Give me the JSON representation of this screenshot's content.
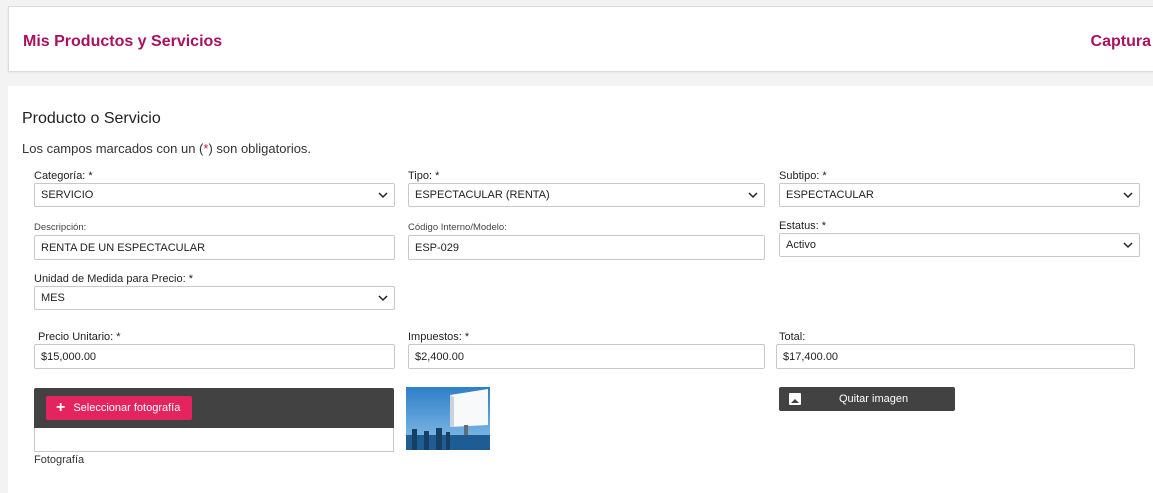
{
  "header": {
    "title": "Mis Productos y Servicios",
    "right_link": "Captura"
  },
  "section": {
    "title": "Producto o Servicio",
    "note_before": "Los campos marcados con un (",
    "note_star": "*",
    "note_after": ") son obligatorios."
  },
  "fields": {
    "categoria": {
      "label": "Categoría: *",
      "value": "SERVICIO"
    },
    "tipo": {
      "label": "Tipo: *",
      "value": "ESPECTACULAR (RENTA)"
    },
    "subtipo": {
      "label": "Subtipo: *",
      "value": "ESPECTACULAR"
    },
    "descripcion": {
      "label": "Descripción:",
      "value": "RENTA DE UN ESPECTACULAR"
    },
    "codigo": {
      "label": "Código Interno/Modelo:",
      "value": "ESP-029"
    },
    "estatus": {
      "label": "Estatus: *",
      "value": "Activo"
    },
    "unidad": {
      "label": "Unidad de Medida para Precio: *",
      "value": "MES"
    },
    "precio": {
      "label": "Precio Unitario: *",
      "value": "$15,000.00"
    },
    "impuestos": {
      "label": "Impuestos: *",
      "value": "$2,400.00"
    },
    "total": {
      "label": "Total:",
      "value": "$17,400.00"
    }
  },
  "photo": {
    "select_button": "Seleccionar fotografía",
    "label": "Fotografía",
    "remove_button": "Quitar imagen"
  },
  "colors": {
    "brand": "#a8125f",
    "accent_button": "#e3245e",
    "dark_bar": "#424242"
  }
}
